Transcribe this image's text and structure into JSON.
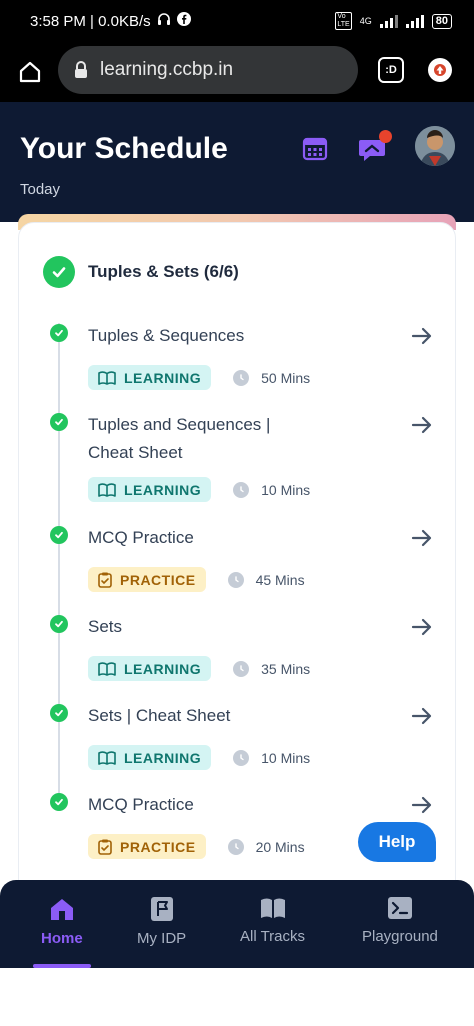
{
  "status_bar": {
    "time": "3:58 PM | 0.0KB/s",
    "network": "4G",
    "battery": "80"
  },
  "browser": {
    "url": "learning.ccbp.in",
    "tab_label": ":D"
  },
  "header": {
    "title": "Your Schedule",
    "subtitle": "Today"
  },
  "section": {
    "title": "Tuples & Sets (6/6)",
    "items": [
      {
        "title": "Tuples & Sequences",
        "tag": "LEARNING",
        "duration": "50 Mins"
      },
      {
        "title": "Tuples and Sequences | Cheat Sheet",
        "tag": "LEARNING",
        "duration": "10 Mins"
      },
      {
        "title": "MCQ Practice",
        "tag": "PRACTICE",
        "duration": "45 Mins"
      },
      {
        "title": "Sets",
        "tag": "LEARNING",
        "duration": "35 Mins"
      },
      {
        "title": "Sets | Cheat Sheet",
        "tag": "LEARNING",
        "duration": "10 Mins"
      },
      {
        "title": "MCQ Practice",
        "tag": "PRACTICE",
        "duration": "20 Mins"
      }
    ]
  },
  "help_label": "Help",
  "bottom_nav": {
    "items": [
      {
        "label": "Home",
        "icon": "home-icon",
        "active": true
      },
      {
        "label": "My IDP",
        "icon": "flag-icon",
        "active": false
      },
      {
        "label": "All Tracks",
        "icon": "book-icon",
        "active": false
      },
      {
        "label": "Playground",
        "icon": "terminal-icon",
        "active": false
      }
    ]
  },
  "colors": {
    "header_bg": "#0e1a33",
    "success": "#22c55e",
    "learning_bg": "#d4f4f3",
    "practice_bg": "#fdf0c6",
    "accent": "#8b5cf6",
    "help": "#1878e3"
  }
}
